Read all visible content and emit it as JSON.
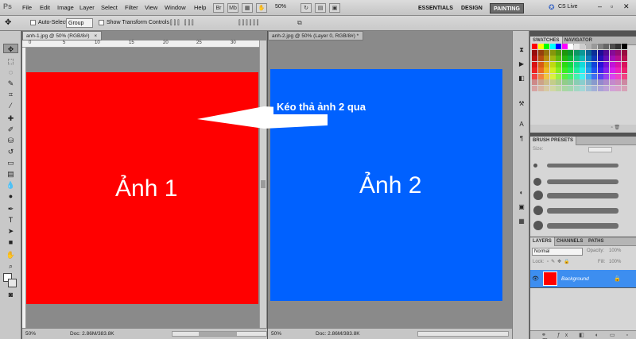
{
  "app": {
    "logo": "Ps",
    "menus": [
      "File",
      "Edit",
      "Image",
      "Layer",
      "Select",
      "Filter",
      "View",
      "Window",
      "Help"
    ],
    "zoom": "50%",
    "workspaces": [
      "ESSENTIALS",
      "DESIGN",
      "PAINTING"
    ],
    "active_workspace": "PAINTING",
    "cs_live": "CS Live"
  },
  "options": {
    "auto_select_label": "Auto-Select:",
    "auto_select_value": "Group",
    "show_transform_label": "Show Transform Controls"
  },
  "doc1": {
    "tab": "anh-1.jpg @ 50% (RGB/8#)",
    "label": "Ảnh 1",
    "zoom": "50%",
    "doc_info": "Doc: 2.86M/383.8K",
    "ruler_numbers": [
      "0",
      "5",
      "10",
      "15",
      "20",
      "25",
      "30"
    ]
  },
  "doc2": {
    "tab": "anh-2.jpg @ 50% (Layer 0, RGB/8#) *",
    "label": "Ảnh 2",
    "zoom": "50%",
    "doc_info": "Doc: 2.86M/383.8K"
  },
  "annotation": {
    "text": "Kéo thả ảnh 2 qua"
  },
  "panels": {
    "swatches_tab": "SWATCHES",
    "navigator_tab": "NAVIGATOR",
    "brush_tab": "BRUSH PRESETS",
    "brush_size_label": "Size:",
    "layers_tab": "LAYERS",
    "channels_tab": "CHANNELS",
    "paths_tab": "PATHS",
    "blend_mode": "Normal",
    "opacity_label": "Opacity:",
    "opacity_value": "100%",
    "lock_label": "Lock:",
    "fill_label": "Fill:",
    "fill_value": "100%",
    "layer_name": "Background"
  }
}
